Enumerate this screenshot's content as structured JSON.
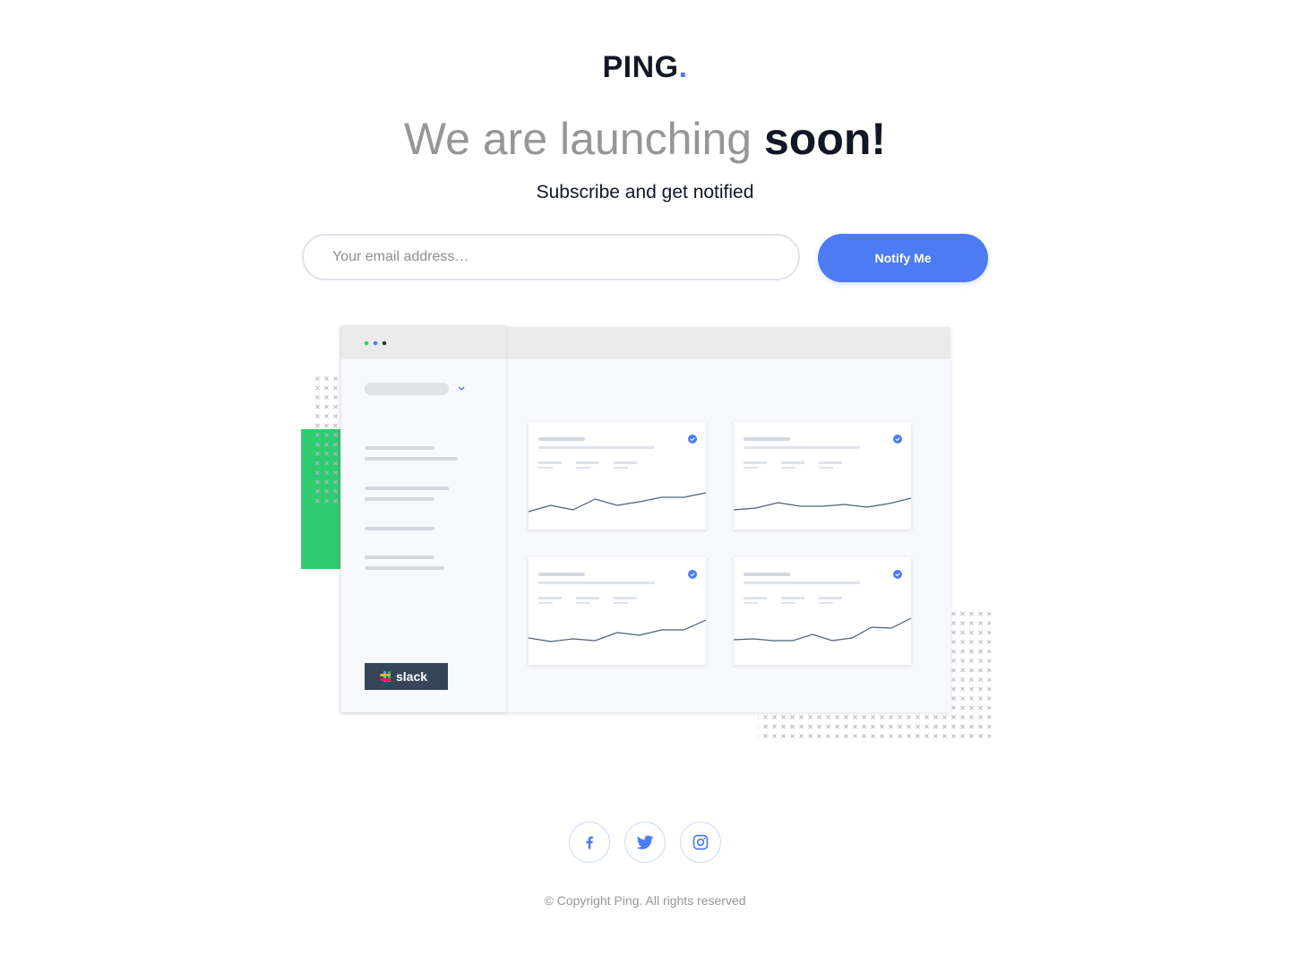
{
  "brand": {
    "name": "PING",
    "dot": "."
  },
  "hero": {
    "title_light": "We are launching ",
    "title_bold": "soon!",
    "subtitle": "Subscribe and get notified"
  },
  "form": {
    "email_placeholder": "Your email address…",
    "email_value": "",
    "submit_label": "Notify Me"
  },
  "dashboard": {
    "slack_label": "slack",
    "cards": [
      {
        "trend": [
          22,
          15,
          20,
          8,
          15,
          11,
          6,
          6,
          1
        ]
      },
      {
        "trend": [
          20,
          18,
          12,
          16,
          16,
          14,
          17,
          13,
          7
        ]
      },
      {
        "trend": [
          12,
          16,
          13,
          15,
          6,
          9,
          3,
          3,
          -8
        ]
      },
      {
        "trend": [
          14,
          13,
          15,
          15,
          8,
          15,
          12,
          0,
          1,
          -10
        ]
      }
    ]
  },
  "social": [
    {
      "name": "facebook-icon"
    },
    {
      "name": "twitter-icon"
    },
    {
      "name": "instagram-icon"
    }
  ],
  "footer": {
    "copyright": "© Copyright Ping. All rights reserved"
  },
  "colors": {
    "accent": "#4c7bf3",
    "dark": "#121725",
    "gray": "#969696",
    "green": "#2ecc71"
  }
}
